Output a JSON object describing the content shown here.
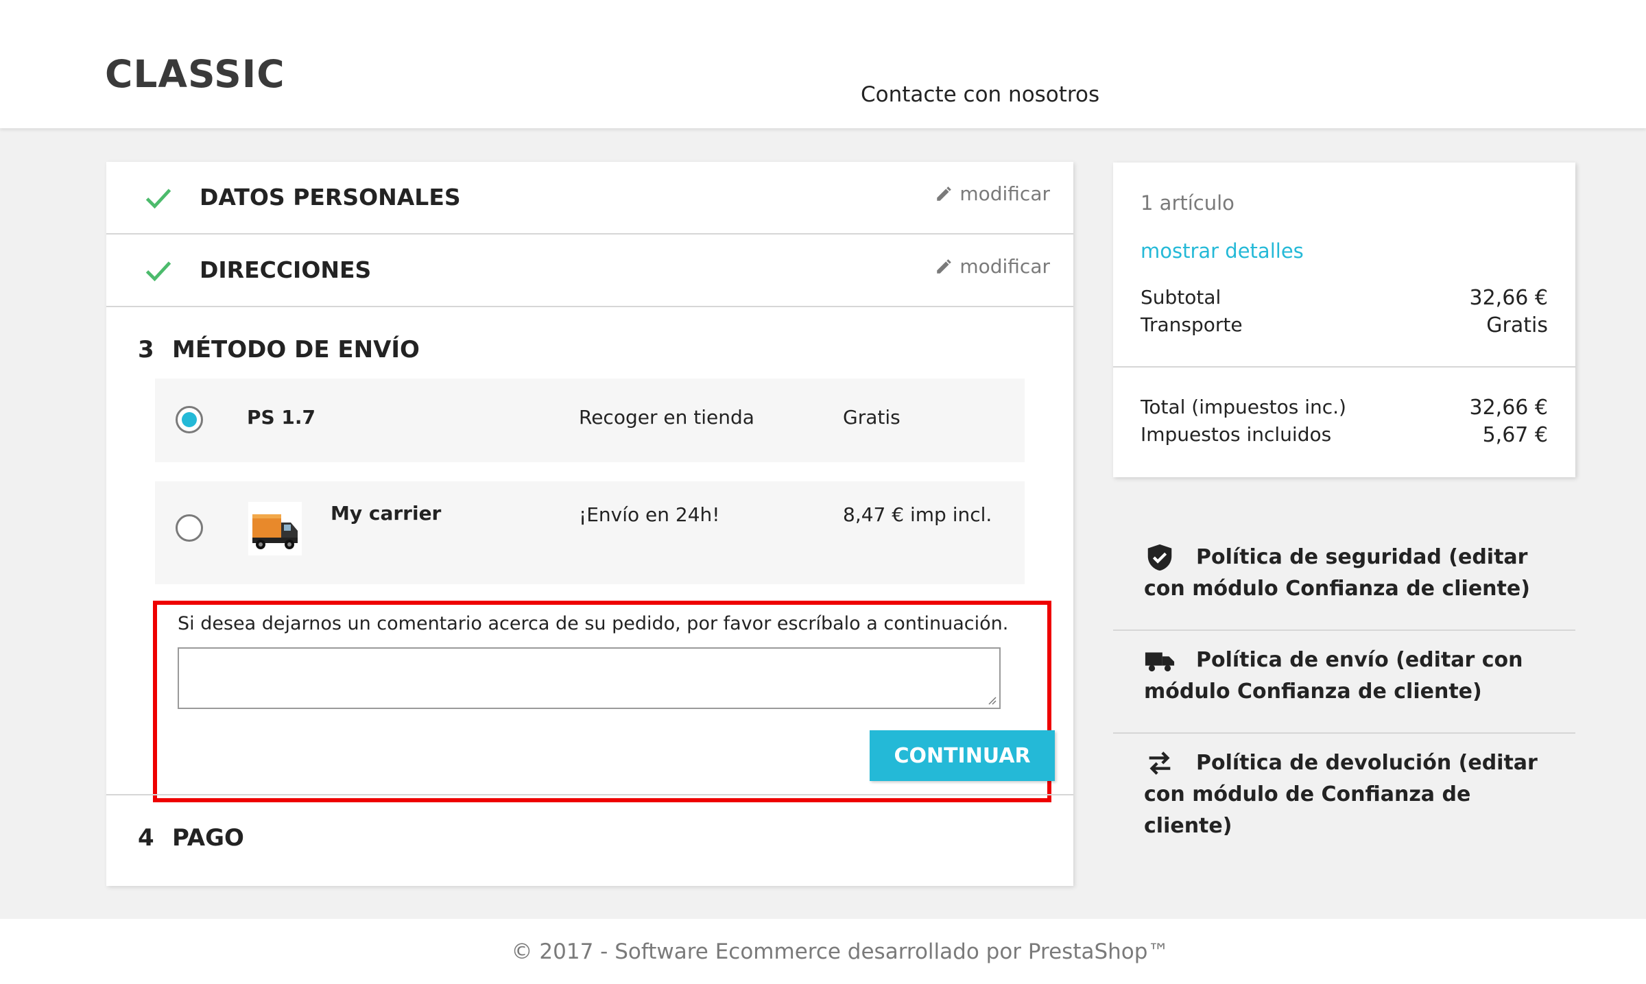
{
  "header": {
    "logo": "CLASSIC",
    "contact_link": "Contacte con nosotros"
  },
  "checkout": {
    "steps": [
      {
        "label": "DATOS PERSONALES",
        "edit_label": "modificar"
      },
      {
        "label": "DIRECCIONES",
        "edit_label": "modificar"
      }
    ],
    "current_step": {
      "number": "3",
      "label": "MÉTODO DE ENVÍO"
    },
    "carriers": [
      {
        "name": "PS 1.7",
        "delay": "Recoger en tienda",
        "price": "Gratis",
        "selected": true
      },
      {
        "name": "My carrier",
        "delay": "¡Envío en 24h!",
        "price": "8,47 € imp incl.",
        "selected": false
      }
    ],
    "comment": {
      "label": "Si desea dejarnos un comentario acerca de su pedido, por favor escríbalo a continuación.",
      "value": "",
      "highlight_color": "#ee0000"
    },
    "continue_label": "CONTINUAR",
    "next_step": {
      "number": "4",
      "label": "PAGO"
    }
  },
  "summary": {
    "items_count": "1 artículo",
    "show_details": "mostrar detalles",
    "subtotal_label": "Subtotal",
    "subtotal_value": "32,66 €",
    "shipping_label": "Transporte",
    "shipping_value": "Gratis",
    "total_label": "Total (impuestos inc.)",
    "total_value": "32,66 €",
    "tax_label": "Impuestos incluidos",
    "tax_value": "5,67 €"
  },
  "reassurance": [
    {
      "icon": "shield-icon",
      "text": "Política de seguridad (editar con módulo Confianza de cliente)"
    },
    {
      "icon": "truck-icon",
      "text": "Política de envío (editar con módulo Confianza de cliente)"
    },
    {
      "icon": "swap-arrows-icon",
      "text": "Política de devolución (editar con módulo de Confianza de cliente)"
    }
  ],
  "footer": {
    "copyright": "© 2017 - Software Ecommerce desarrollado por PrestaShop™"
  },
  "colors": {
    "accent": "#24b9d7",
    "check": "#4cbb6c",
    "highlight": "#ee0000"
  }
}
